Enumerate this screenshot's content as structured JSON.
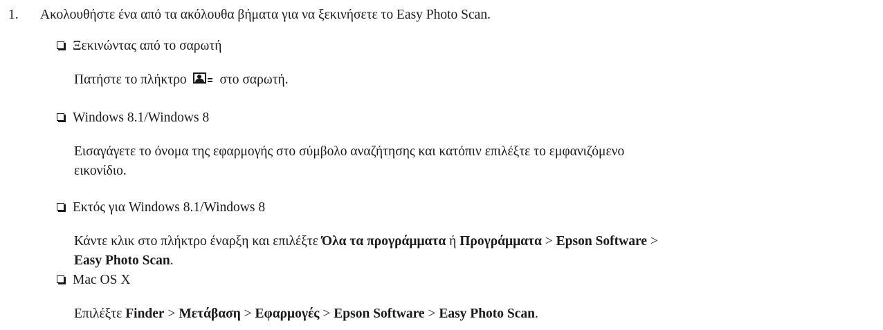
{
  "step": {
    "number": "1.",
    "text": "Ακολουθήστε ένα από τα ακόλουθα βήματα για να ξεκινήσετε το Easy Photo Scan."
  },
  "options": [
    {
      "title": "Ξεκινώντας από το σαρωτή",
      "desc_before": "Πατήστε το πλήκτρο",
      "icon": "photo-scan-button-icon",
      "desc_after": "στο σαρωτή."
    },
    {
      "title": "Windows 8.1/Windows 8",
      "desc_line1": "Εισαγάγετε το όνομα της εφαρμογής στο σύμβολο αναζήτησης και κατόπιν επιλέξτε το εμφανιζόμενο",
      "desc_line2": "εικονίδιο."
    },
    {
      "title": "Εκτός για Windows 8.1/Windows 8",
      "desc_prefix": "Κάντε κλικ στο πλήκτρο έναρξη και επιλέξτε ",
      "all_programs": "Όλα τα προγράμματα",
      "or": " ή ",
      "programs": "Προγράμματα",
      "sep": " > ",
      "epson_software": "Epson Software",
      "easy_photo_scan": "Easy Photo Scan",
      "end": "."
    },
    {
      "title": "Mac OS X",
      "desc_prefix": "Επιλέξτε ",
      "finder": "Finder",
      "go": "Μετάβαση",
      "applications": "Εφαρμογές",
      "epson_software": "Epson Software",
      "easy_photo_scan": "Easy Photo Scan",
      "sep": " > ",
      "end": "."
    }
  ]
}
